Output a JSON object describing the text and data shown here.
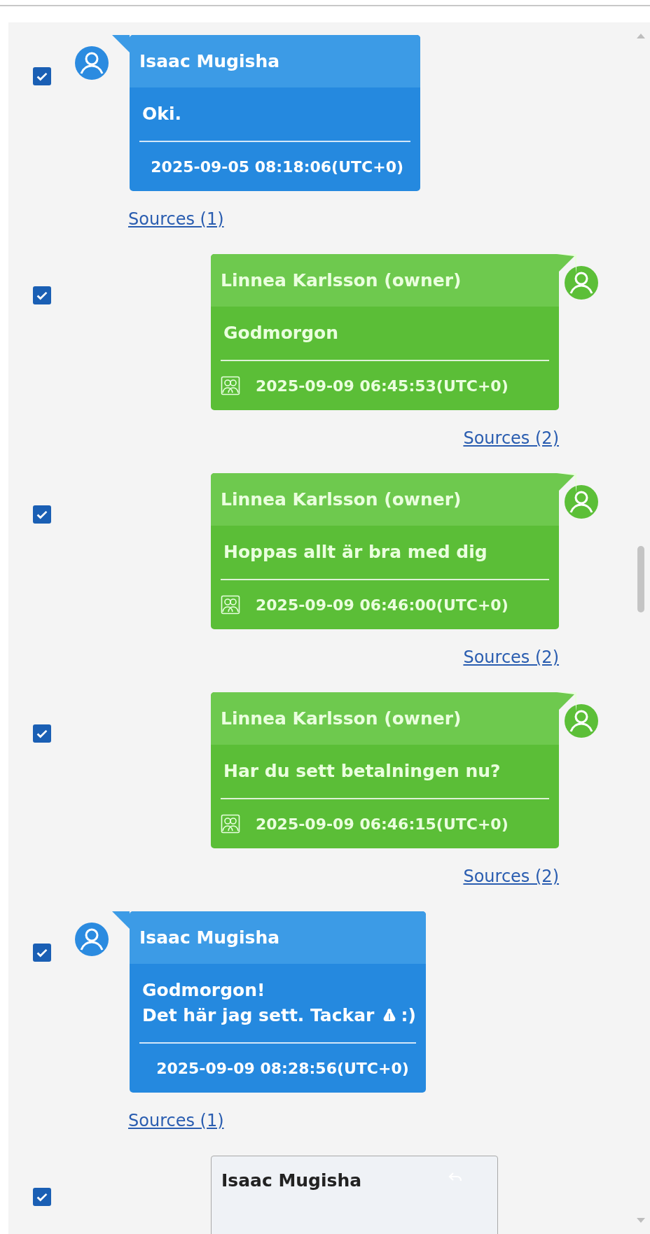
{
  "messages": [
    {
      "kind": "incoming",
      "checked": true,
      "sender": "Isaac Mugisha",
      "lines": [
        [
          {
            "kind": "text",
            "text": "Oki."
          }
        ]
      ],
      "timestamp": "2025-09-05 08:18:06(UTC+0)",
      "group": false,
      "sources": "Sources (1)"
    },
    {
      "kind": "outgoing",
      "checked": true,
      "sender": "Linnea Karlsson (owner)",
      "lines": [
        [
          {
            "kind": "text",
            "text": "Godmorgon"
          }
        ]
      ],
      "timestamp": "2025-09-09 06:45:53(UTC+0)",
      "group": true,
      "sources": "Sources (2)"
    },
    {
      "kind": "outgoing",
      "checked": true,
      "sender": "Linnea Karlsson (owner)",
      "lines": [
        [
          {
            "kind": "text",
            "text": "Hoppas allt är bra med dig"
          }
        ]
      ],
      "timestamp": "2025-09-09 06:46:00(UTC+0)",
      "group": true,
      "sources": "Sources (2)"
    },
    {
      "kind": "outgoing",
      "checked": true,
      "sender": "Linnea Karlsson (owner)",
      "lines": [
        [
          {
            "kind": "text",
            "text": "Har du sett betalningen nu?"
          }
        ]
      ],
      "timestamp": "2025-09-09 06:46:15(UTC+0)",
      "group": true,
      "sources": "Sources (2)"
    },
    {
      "kind": "incoming",
      "checked": true,
      "sender": "Isaac Mugisha",
      "lines": [
        [
          {
            "kind": "text",
            "text": "Godmorgon!"
          }
        ],
        [
          {
            "kind": "text",
            "text": "Det här jag sett. Tackar"
          },
          {
            "kind": "emoji"
          },
          {
            "kind": "text",
            "text": ":)"
          }
        ]
      ],
      "timestamp": "2025-09-09 08:28:56(UTC+0)",
      "group": false,
      "sources": "Sources (1)"
    },
    {
      "kind": "quote",
      "checked": true,
      "sender": "Isaac Mugisha"
    }
  ]
}
